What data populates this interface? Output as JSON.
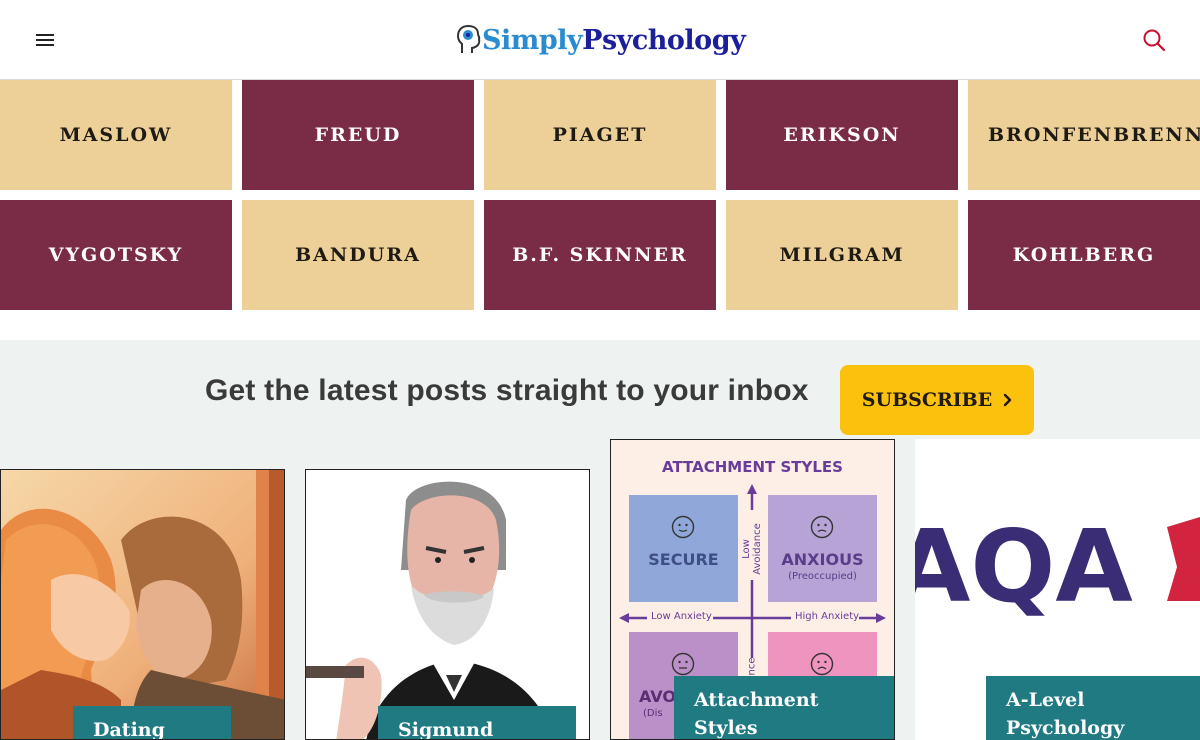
{
  "header": {
    "logo": {
      "part1": "Simply",
      "part2": "Psychology"
    }
  },
  "theorists": {
    "row1": [
      "MASLOW",
      "FREUD",
      "PIAGET",
      "ERIKSON",
      "BRONFENBRENNER"
    ],
    "row2": [
      "VYGOTSKY",
      "BANDURA",
      "B.F. SKINNER",
      "MILGRAM",
      "KOHLBERG"
    ]
  },
  "newsletter": {
    "text": "Get the latest posts straight to your inbox",
    "button": "SUBSCRIBE",
    "button_icon": "chevron-right-icon"
  },
  "cards": [
    {
      "title": "Dating Tips"
    },
    {
      "title": "Sigmund Freud"
    },
    {
      "title_line1": "Attachment",
      "title_line2": "Styles"
    },
    {
      "title_line1": "A-Level",
      "title_line2": "Psychology"
    }
  ],
  "attachment_chart": {
    "title": "ATTACHMENT STYLES",
    "quadrants": [
      "SECURE",
      "ANXIOUS",
      "AVO",
      "(Preoccupied)",
      "(Dis"
    ],
    "axis": {
      "low_anxiety": "Low Anxiety",
      "high_anxiety": "High Anxiety",
      "low_avoidance": "Low Avoidance",
      "avoidance_cut": "nce"
    }
  },
  "aqa_logo": {
    "text": "AQA"
  },
  "colors": {
    "tan": "#edd098",
    "maroon": "#7a2b46",
    "teal": "#1f7a82",
    "yellow": "#fcc10d",
    "brand_blue": "#2a8bd0",
    "brand_navy": "#1b1f9a",
    "search_red": "#c8102e"
  }
}
